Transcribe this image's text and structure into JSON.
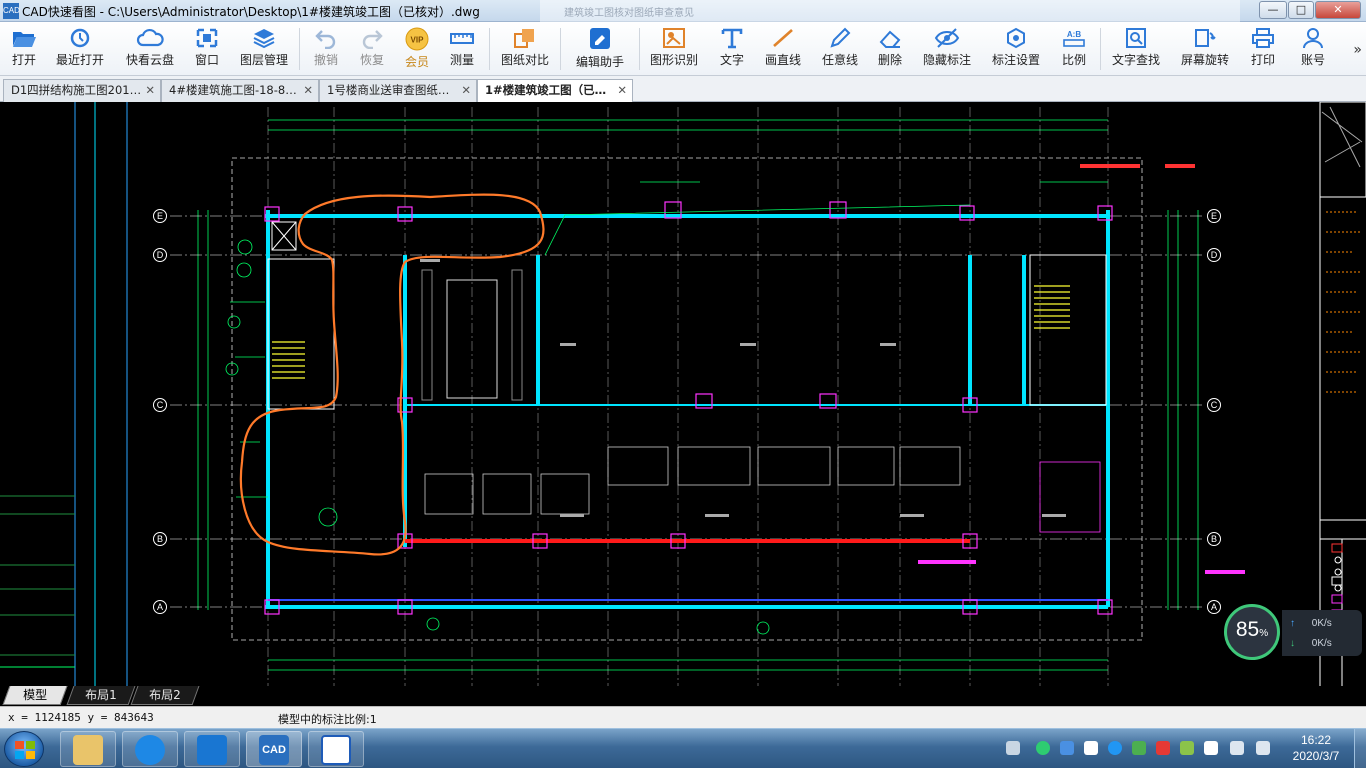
{
  "window": {
    "title": "CAD快速看图 - C:\\Users\\Administrator\\Desktop\\1#楼建筑竣工图（已核对）.dwg",
    "app_icon_text": "CAD",
    "background_window_title": "建筑竣工图核对图纸审查意见"
  },
  "window_buttons": {
    "minimize": "—",
    "maximize": "□",
    "close": "✕"
  },
  "toolbar": [
    {
      "id": "open",
      "label": "打开",
      "icon": "folder-open-icon"
    },
    {
      "id": "recent",
      "label": "最近打开",
      "icon": "history-icon"
    },
    {
      "id": "cloud",
      "label": "快看云盘",
      "icon": "cloud-icon"
    },
    {
      "id": "window",
      "label": "窗口",
      "icon": "window-icon"
    },
    {
      "id": "layers",
      "label": "图层管理",
      "icon": "layers-icon"
    },
    {
      "id": "undo",
      "label": "撤销",
      "icon": "undo-icon"
    },
    {
      "id": "redo",
      "label": "恢复",
      "icon": "redo-icon"
    },
    {
      "id": "vip",
      "label": "会员",
      "icon": "vip-badge-icon"
    },
    {
      "id": "measure",
      "label": "测量",
      "icon": "ruler-icon"
    },
    {
      "id": "compare",
      "label": "图纸对比",
      "icon": "compare-icon"
    },
    {
      "id": "edit-assist",
      "label": "编辑助手",
      "icon": "edit-assistant-icon"
    },
    {
      "id": "shape-recog",
      "label": "图形识别",
      "icon": "shape-recognize-icon"
    },
    {
      "id": "text",
      "label": "文字",
      "icon": "text-icon"
    },
    {
      "id": "line",
      "label": "画直线",
      "icon": "line-icon"
    },
    {
      "id": "freeline",
      "label": "任意线",
      "icon": "pencil-icon"
    },
    {
      "id": "delete",
      "label": "删除",
      "icon": "eraser-icon"
    },
    {
      "id": "hide-annot",
      "label": "隐藏标注",
      "icon": "eye-hide-icon"
    },
    {
      "id": "annot-settings",
      "label": "标注设置",
      "icon": "settings-icon"
    },
    {
      "id": "scale",
      "label": "比例",
      "icon": "scale-icon"
    },
    {
      "id": "find-text",
      "label": "文字查找",
      "icon": "find-text-icon"
    },
    {
      "id": "rotate",
      "label": "屏幕旋转",
      "icon": "rotate-icon"
    },
    {
      "id": "print",
      "label": "打印",
      "icon": "printer-icon"
    },
    {
      "id": "account",
      "label": "账号",
      "icon": "user-icon"
    }
  ],
  "toolbar_more": "»",
  "vip_badge_text": "VIP",
  "scale_icon_text": "A:B",
  "tabs": [
    {
      "label": "D1四拼结构施工图201…",
      "active": false
    },
    {
      "label": "4#楼建筑施工图-18-8…",
      "active": false
    },
    {
      "label": "1号楼商业送审查图纸…",
      "active": false
    },
    {
      "label": "1#楼建筑竣工图（已…",
      "active": true
    }
  ],
  "tab_close": "✕",
  "grid_labels": {
    "rows": [
      "E",
      "D",
      "C",
      "B",
      "A"
    ]
  },
  "speed_widget": {
    "percent": "85",
    "percent_unit": "%",
    "upload": "0K/s",
    "download": "0K/s",
    "up_arrow": "↑",
    "down_arrow": "↓"
  },
  "layout_tabs": [
    {
      "label": "模型",
      "active": true
    },
    {
      "label": "布局1",
      "active": false
    },
    {
      "label": "布局2",
      "active": false
    }
  ],
  "status": {
    "coordinates": "x = 1124185 y = 843643",
    "scale_text": "模型中的标注比例:1"
  },
  "taskbar": {
    "apps": [
      "file-explorer",
      "browser",
      "text-tool",
      "cad-viewer",
      "word"
    ],
    "clock_time": "16:22",
    "clock_date": "2020/3/7"
  },
  "colors": {
    "canvas_bg": "#000000",
    "wall": "#00e5ff",
    "grid_line": "#ffffff",
    "dim_line": "#00ff66",
    "annotation": "#ff7a2a",
    "magenta": "#ff33ff",
    "red_wall": "#ff1a1a",
    "stair": "#ffff33"
  }
}
